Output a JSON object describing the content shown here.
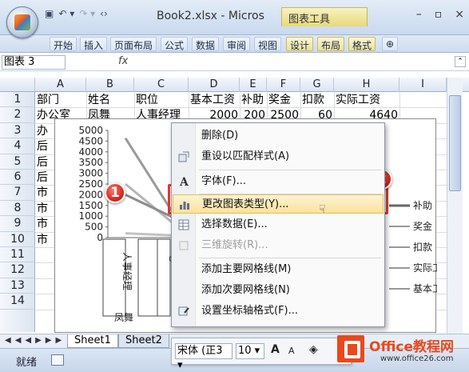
{
  "window": {
    "title": "Book2.xlsx - Micros",
    "context_tab": "图表工具",
    "controls": [
      "–",
      "▫",
      "×"
    ]
  },
  "qat": {
    "save": "▣",
    "undo": "↶ ▾",
    "redo": "↷ ▾",
    "customize": "‹›"
  },
  "ribbon_tabs": [
    "开始",
    "插入",
    "页面布局",
    "公式",
    "数据",
    "审阅",
    "视图",
    "设计",
    "布局",
    "格式",
    "⊕"
  ],
  "formula_bar": {
    "name_box": "图表 3",
    "fx": "fx",
    "value": ""
  },
  "columns": [
    "A",
    "B",
    "C",
    "D",
    "E",
    "F",
    "G",
    "H",
    "I"
  ],
  "rows": [
    "1",
    "2",
    "3",
    "4",
    "5",
    "6",
    "7",
    "8",
    "9",
    "10",
    "11",
    "12",
    "13",
    "14"
  ],
  "sheet": {
    "header": [
      "部门",
      "姓名",
      "职位",
      "基本工资",
      "补助",
      "奖金",
      "扣款",
      "实际工资"
    ],
    "row2": [
      "办公室",
      "凤舞",
      "人事经理",
      "2000",
      "200",
      "2500",
      "60",
      "4640"
    ],
    "col_a_visible": [
      "办",
      "后",
      "后",
      "后",
      "市",
      "市",
      "市",
      "市"
    ]
  },
  "chart": {
    "y_ticks": [
      "5000",
      "4500",
      "4000",
      "3500",
      "3000",
      "2500",
      "2000",
      "1500",
      "1000",
      "500",
      "0"
    ],
    "category_labels": [
      "人事经理",
      "凤舞",
      "电"
    ],
    "legend": [
      "补助",
      "奖金",
      "扣款",
      "实际工",
      "基本工"
    ]
  },
  "chart_data": {
    "type": "line",
    "y_ticks": [
      "5000",
      "4500",
      "4000",
      "3500",
      "3000",
      "2500",
      "2000",
      "1500",
      "1000",
      "500",
      "0"
    ],
    "ylim": [
      0,
      5000
    ],
    "x_ticks": [
      "人事经理",
      "凤舞",
      "电"
    ],
    "legend": [
      "补助",
      "奖金",
      "扣款",
      "实际工",
      "基本工"
    ],
    "series": [
      {
        "values": [
          4640,
          1000
        ]
      },
      {
        "values": [
          2500,
          600
        ]
      },
      {
        "values": [
          2000,
          900
        ]
      },
      {
        "values": [
          200,
          100
        ]
      }
    ]
  },
  "context_menu": {
    "items": [
      {
        "label": "删除(D)"
      },
      {
        "label": "重设以匹配样式(A)"
      },
      {
        "label": "字体(F)..."
      },
      {
        "label": "更改图表类型(Y)..."
      },
      {
        "label": "选择数据(E)..."
      },
      {
        "label": "三维旋转(R)..."
      },
      {
        "label": "添加主要网格线(M)"
      },
      {
        "label": "添加次要网格线(N)"
      },
      {
        "label": "设置坐标轴格式(F)..."
      }
    ]
  },
  "callouts": [
    "1",
    "2"
  ],
  "sheet_tabs": [
    "Sheet1",
    "Sheet2"
  ],
  "status": {
    "ready": "就绪"
  },
  "mini_toolbar": {
    "font": "宋体 (正3 ▾",
    "size": "10 ▾",
    "grow": "A",
    "shrink": "A",
    "fill": "◈"
  },
  "watermark": {
    "brand": "Office教程网",
    "url": "www.office26.com"
  }
}
